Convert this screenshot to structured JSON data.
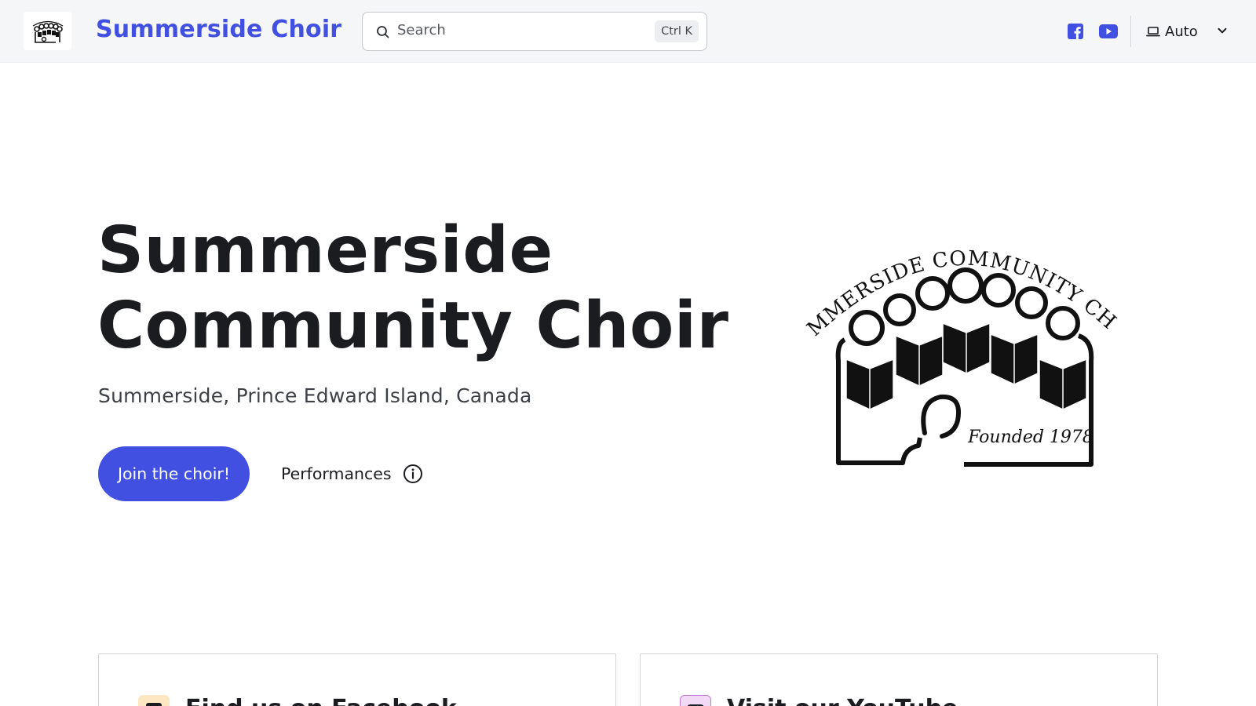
{
  "header": {
    "site_title": "Summerside Choir",
    "logo_icon": "choir-logo-icon",
    "search": {
      "placeholder": "Search",
      "shortcut": "Ctrl K"
    },
    "social": [
      {
        "icon": "facebook-icon"
      },
      {
        "icon": "youtube-icon"
      }
    ],
    "theme": {
      "icon": "laptop-icon",
      "label": "Auto"
    }
  },
  "hero": {
    "title_line1": "Summerside",
    "title_line2": "Community Choir",
    "subtitle": "Summerside, Prince Edward Island, Canada",
    "primary_button": "Join the choir!",
    "secondary_button": "Performances",
    "logo": {
      "icon": "summerside-community-choir-logo",
      "arc_text": "SUMMERSIDE COMMUNITY CHOIR",
      "founded_text": "Founded 1978"
    }
  },
  "cards": [
    {
      "title": "Find us on Facebook",
      "icon": "facebook-icon",
      "icon_bg": "#fde7c3"
    },
    {
      "title": "Visit our YouTube",
      "icon": "youtube-icon",
      "icon_bg": "#f2d9f6"
    }
  ],
  "colors": {
    "accent": "#4150e0",
    "text": "#1b1c20",
    "header_bg": "#f5f6f8"
  }
}
